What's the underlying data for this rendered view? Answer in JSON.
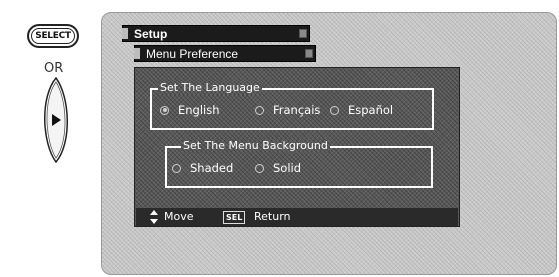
{
  "remote": {
    "select_label": "SELECT",
    "or_label": "OR"
  },
  "menu": {
    "title": "Setup",
    "subtitle": "Menu Preference"
  },
  "language_group": {
    "label": "Set The Language",
    "options": [
      {
        "label": "English",
        "selected": true
      },
      {
        "label": "Français",
        "selected": false
      },
      {
        "label": "Español",
        "selected": false
      }
    ]
  },
  "background_group": {
    "label": "Set The Menu Background",
    "options": [
      {
        "label": "Shaded",
        "selected": false
      },
      {
        "label": "Solid",
        "selected": false
      }
    ]
  },
  "nav": {
    "move_label": "Move",
    "sel_key": "SEL",
    "return_label": "Return"
  },
  "colors": {
    "panel_bg": "#c9c9c9",
    "dark_area": "#595959",
    "bar": "#1b1b1b",
    "text": "#ffffff"
  }
}
